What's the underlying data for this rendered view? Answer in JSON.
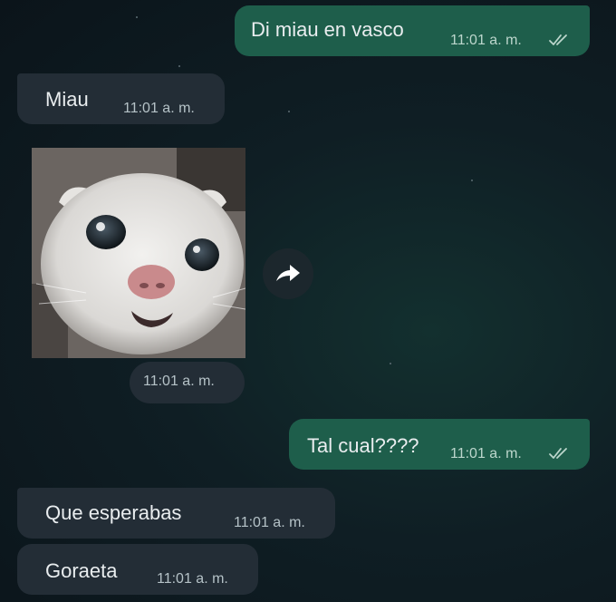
{
  "colors": {
    "background": "#0b141a",
    "outgoing_bubble": "#1e5e4b",
    "incoming_bubble": "#232d36",
    "text": "#e9edef",
    "timestamp": "#b5c2c7"
  },
  "messages": [
    {
      "direction": "outgoing",
      "text": "Di miau en vasco",
      "time": "11:01 a. m.",
      "status_icon": "double-check-icon"
    },
    {
      "direction": "incoming",
      "text": "Miau",
      "time": "11:01 a. m."
    },
    {
      "direction": "incoming",
      "type": "sticker",
      "sticker_icon": "white-cat-sticker",
      "time": "11:01 a. m.",
      "action_icon": "forward-arrow-icon"
    },
    {
      "direction": "outgoing",
      "text": "Tal cual????",
      "time": "11:01 a. m.",
      "status_icon": "double-check-icon"
    },
    {
      "direction": "incoming",
      "text": "Que esperabas",
      "time": "11:01 a. m."
    },
    {
      "direction": "incoming",
      "text": "Goraeta",
      "time": "11:01 a. m."
    }
  ]
}
